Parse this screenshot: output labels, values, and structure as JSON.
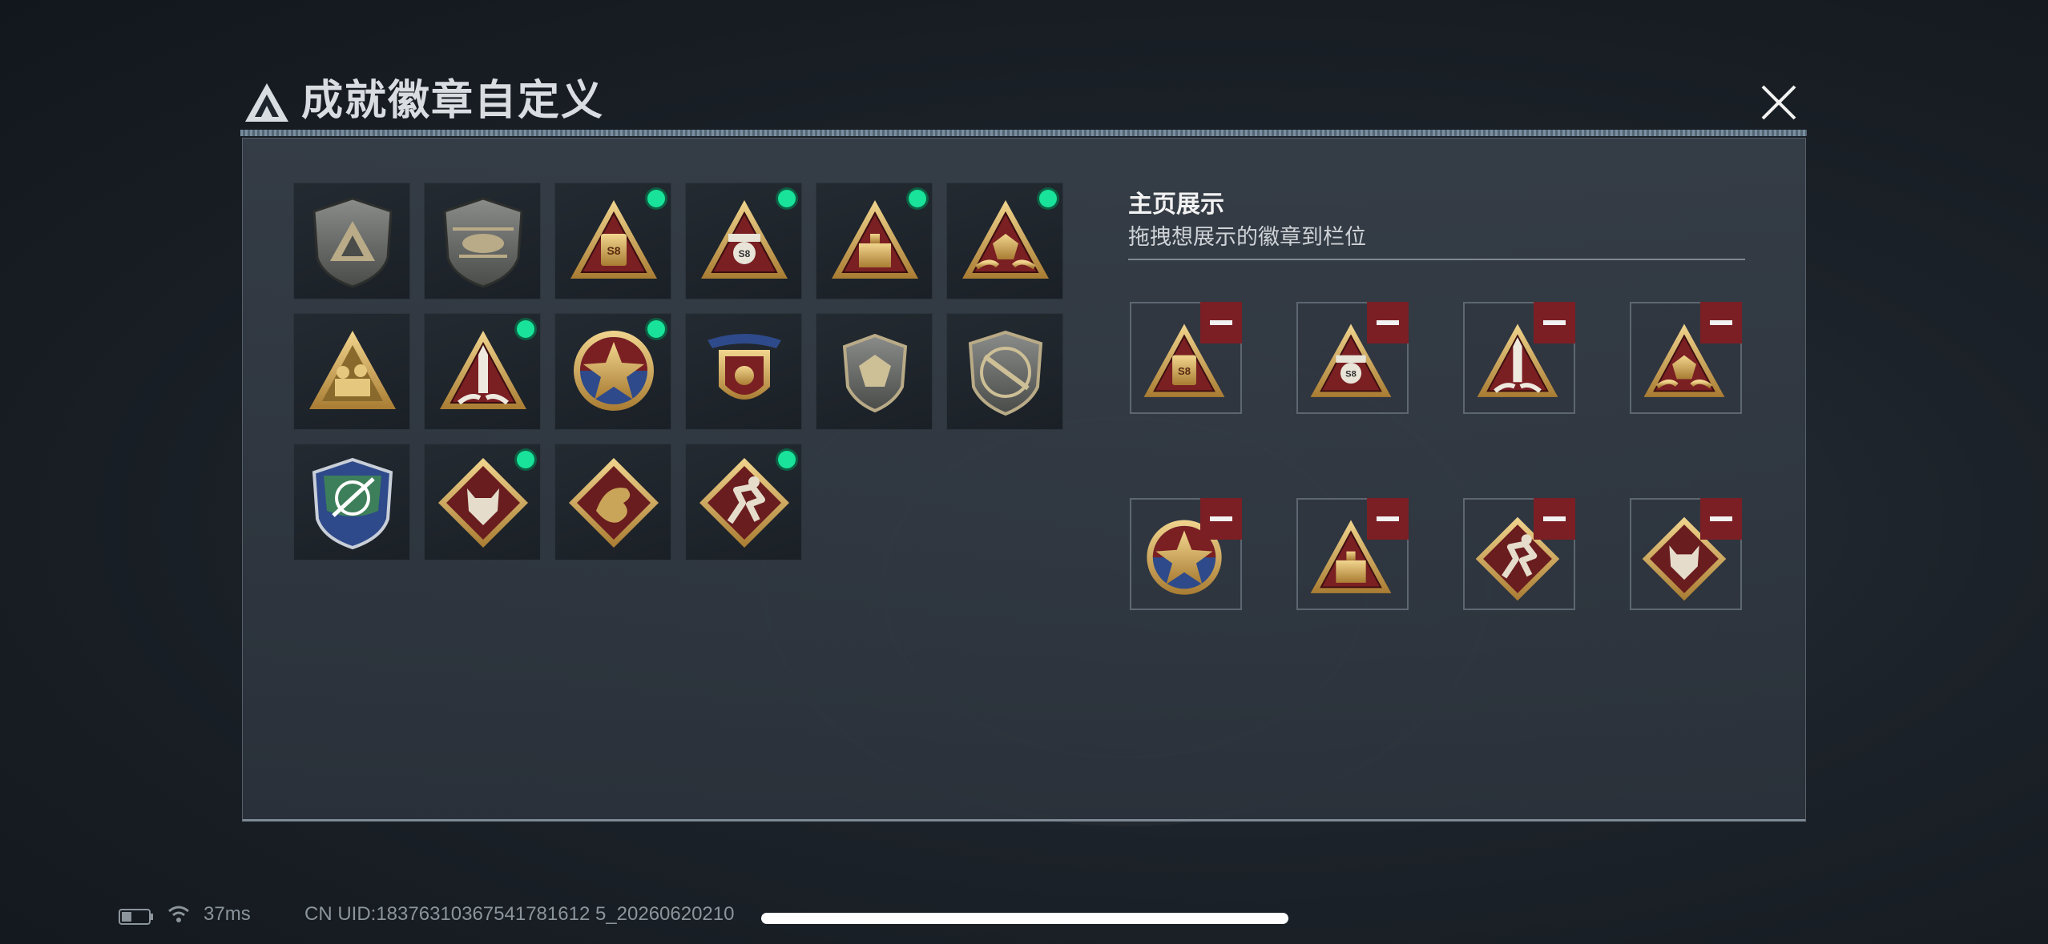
{
  "window": {
    "title": "成就徽章自定义",
    "close_icon": "close-x-icon"
  },
  "badge_grid": [
    {
      "name": "shield-triangle-badge",
      "new": false
    },
    {
      "name": "helicopter-shield-badge",
      "new": false
    },
    {
      "name": "battery-triangle-badge",
      "new": true
    },
    {
      "name": "robot-triangle-badge",
      "new": true
    },
    {
      "name": "crate-triangle-badge",
      "new": true
    },
    {
      "name": "gem-hands-triangle-badge",
      "new": true
    },
    {
      "name": "squad-triangle-badge",
      "new": false
    },
    {
      "name": "rocket-triangle-badge",
      "new": true
    },
    {
      "name": "star-wheel-badge",
      "new": true
    },
    {
      "name": "winged-crest-badge",
      "new": false
    },
    {
      "name": "gem-shield-badge",
      "new": false
    },
    {
      "name": "rifle-shield-badge",
      "new": false
    },
    {
      "name": "crosshair-wings-badge",
      "new": false
    },
    {
      "name": "wolf-diamond-badge",
      "new": true
    },
    {
      "name": "dragon-diamond-badge",
      "new": false
    },
    {
      "name": "runner-diamond-badge",
      "new": true
    }
  ],
  "showcase": {
    "title": "主页展示",
    "subtitle": "拖拽想展示的徽章到栏位",
    "slots": [
      "battery-triangle-badge",
      "robot-triangle-badge",
      "rocket-triangle-badge",
      "gem-hands-triangle-badge",
      "star-wheel-badge",
      "crate-triangle-badge",
      "runner-diamond-badge",
      "wolf-diamond-badge"
    ]
  },
  "status_bar": {
    "ping": "37ms",
    "uid": "CN UID:18376310367541781612 5_20260620210"
  },
  "colors": {
    "new_dot": "#19e29a",
    "remove_button": "#7b1f24",
    "badge_gold": "#c9a55a",
    "badge_red": "#7a1f22"
  }
}
